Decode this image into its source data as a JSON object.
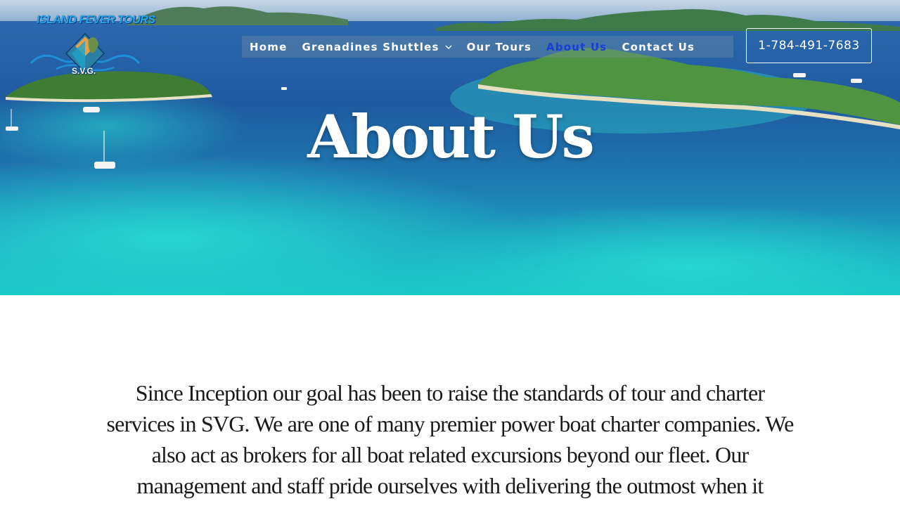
{
  "header": {
    "logo": {
      "brand_text": "ISLAND FEVER TOURS",
      "sub_text": "S.V.G."
    },
    "nav": {
      "items": [
        {
          "label": "Home",
          "active": false
        },
        {
          "label": "Grenadines Shuttles",
          "active": false,
          "has_dropdown": true
        },
        {
          "label": "Our Tours",
          "active": false
        },
        {
          "label": "About Us",
          "active": true
        },
        {
          "label": "Contact Us",
          "active": false
        }
      ]
    },
    "phone_button": {
      "label": "1-784-491-7683"
    }
  },
  "hero": {
    "title": "About Us"
  },
  "main": {
    "intro_text": "Since Inception our goal has been to raise the standards of tour and charter services in SVG. We are one of many premier power boat charter companies. We also act as brokers for all boat related excursions beyond our fleet. Our management and staff pride ourselves with delivering the outmost when it"
  },
  "colors": {
    "active_nav": "#1a3dd6",
    "nav_text": "#ffffff",
    "body_text": "#1a1a1a",
    "ocean_deep": "#1d4f8c",
    "ocean_turquoise": "#18c4c8",
    "island_green": "#3f8a3a"
  }
}
